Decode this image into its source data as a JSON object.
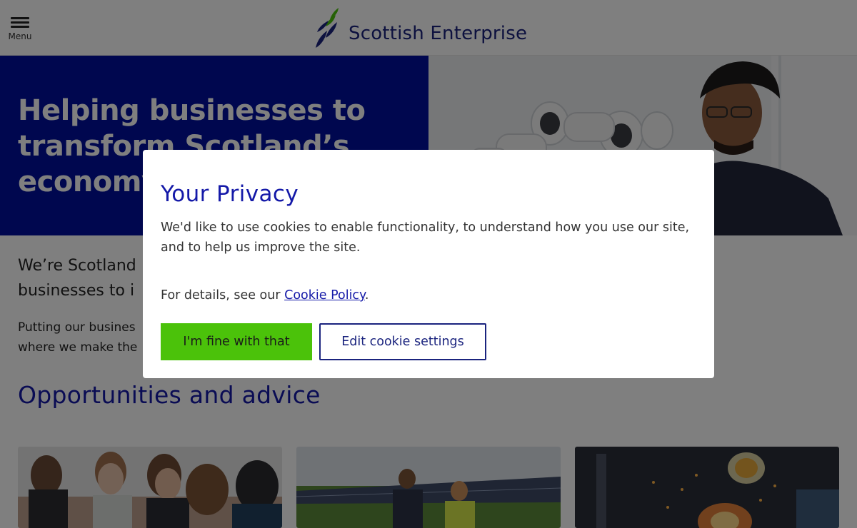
{
  "header": {
    "menu_label": "Menu",
    "logo_text": "Scottish Enterprise"
  },
  "hero": {
    "title": "Helping businesses to transform Scotland’s economy"
  },
  "intro": {
    "lead": "We’re Scotland",
    "lead_line2": "businesses to i",
    "body_line1": "Putting our busines",
    "body_line2": "where we make the"
  },
  "opportunities": {
    "title": "Opportunities and advice"
  },
  "cookie_modal": {
    "title": "Your Privacy",
    "text": "We'd like to use cookies to enable functionality, to understand how you use our site, and to help us improve the site.",
    "details_prefix": "For details, see our ",
    "policy_link": "Cookie Policy",
    "details_suffix": ".",
    "accept_label": "I'm fine with that",
    "edit_label": "Edit cookie settings"
  },
  "colors": {
    "brand_blue": "#000f9f",
    "heading_blue": "#1419a8",
    "accept_green": "#4bc20a"
  }
}
